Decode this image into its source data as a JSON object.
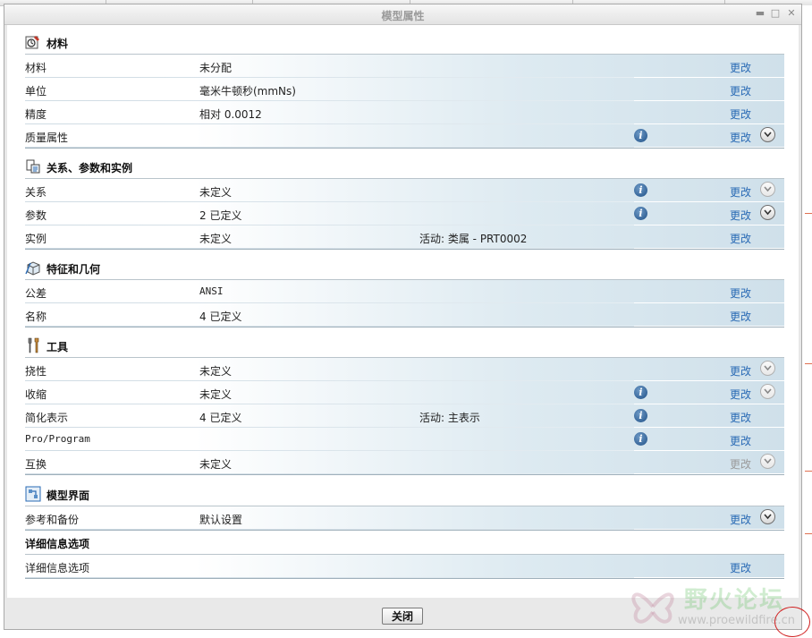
{
  "window": {
    "title": "模型属性",
    "close_button_label": "关闭"
  },
  "sections": {
    "materials": {
      "title": "材料",
      "rows": [
        {
          "label": "材料",
          "value": "未分配",
          "change": "更改"
        },
        {
          "label": "单位",
          "value": "毫米牛顿秒(mmNs)",
          "change": "更改"
        },
        {
          "label": "精度",
          "value": "相对 0.0012",
          "change": "更改"
        },
        {
          "label": "质量属性",
          "value": "",
          "change": "更改"
        }
      ]
    },
    "relations": {
      "title": "关系、参数和实例",
      "rows": [
        {
          "label": "关系",
          "value": "未定义",
          "change": "更改"
        },
        {
          "label": "参数",
          "value": "2 已定义",
          "change": "更改"
        },
        {
          "label": "实例",
          "value": "未定义",
          "extra": "活动: 类属 - PRT0002",
          "change": "更改"
        }
      ]
    },
    "features": {
      "title": "特征和几何",
      "rows": [
        {
          "label": "公差",
          "value": "ANSI",
          "change": "更改"
        },
        {
          "label": "名称",
          "value": "4 已定义",
          "change": "更改"
        }
      ]
    },
    "tools": {
      "title": "工具",
      "rows": [
        {
          "label": "挠性",
          "value": "未定义",
          "change": "更改"
        },
        {
          "label": "收缩",
          "value": "未定义",
          "change": "更改"
        },
        {
          "label": "简化表示",
          "value": "4 已定义",
          "extra": "活动: 主表示",
          "change": "更改"
        },
        {
          "label": "Pro/Program",
          "value": "",
          "change": "更改"
        },
        {
          "label": "互换",
          "value": "未定义",
          "change": "更改"
        }
      ]
    },
    "interface": {
      "title": "模型界面",
      "rows": [
        {
          "label": "参考和备份",
          "value": "默认设置",
          "change": "更改"
        }
      ]
    },
    "detail": {
      "title": "详细信息选项",
      "rows": [
        {
          "label": "详细信息选项",
          "value": "",
          "change": "更改"
        }
      ]
    }
  },
  "watermark": {
    "text": "野火论坛",
    "url": "www.proewildfire.cn"
  },
  "icons": {
    "info": "info-icon",
    "expand": "chevron-down-circle-icon"
  }
}
